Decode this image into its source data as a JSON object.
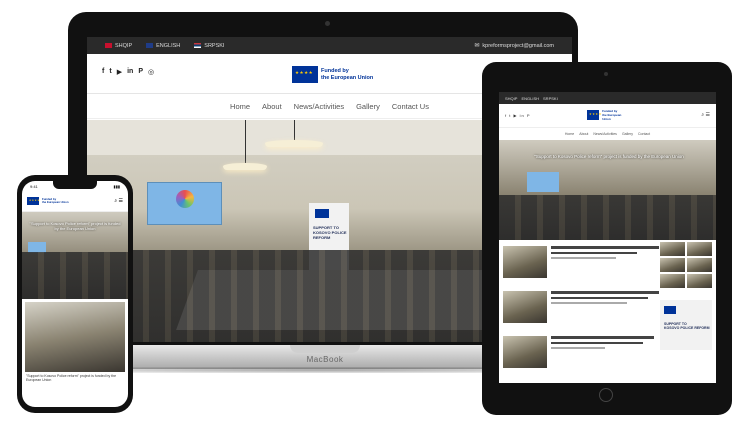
{
  "laptop": {
    "brand": "MacBook",
    "topbar": {
      "languages": [
        {
          "label": "SHQIP",
          "flag": "al"
        },
        {
          "label": "ENGLISH",
          "flag": "en"
        },
        {
          "label": "SRPSKI",
          "flag": "sr"
        }
      ],
      "email": "kpreformsproject@gmail.com"
    },
    "header": {
      "social_icons": [
        "facebook-icon",
        "twitter-icon",
        "youtube-icon",
        "linkedin-icon",
        "pinterest-icon",
        "instagram-icon"
      ],
      "social_glyphs": [
        "f",
        "t",
        "▶",
        "in",
        "P",
        "◎"
      ],
      "eu_logo_line1": "Funded by",
      "eu_logo_line2": "the European Union"
    },
    "nav": [
      "Home",
      "About",
      "News/Activities",
      "Gallery",
      "Contact Us"
    ],
    "hero": {
      "banner_line1": "SUPPORT TO",
      "banner_line2": "KOSOVO POLICE",
      "banner_line3": "REFORM"
    }
  },
  "tablet": {
    "topbar_items": [
      "SHQIP",
      "ENGLISH",
      "SRPSKI"
    ],
    "social": "f t ▶ in P",
    "nav": [
      "Home",
      "About",
      "News/Activities",
      "Gallery",
      "Contact"
    ],
    "hero_caption": "\"Support to Kosovo Police reform\" project is funded by the European Union",
    "icons": "⌕ ☰",
    "side_banner_line1": "SUPPORT TO",
    "side_banner_line2": "KOSOVO POLICE REFORM"
  },
  "phone": {
    "time": "9:41",
    "battery": "▮▮▮",
    "hero_caption": "\"Support to Kosovo Police reform\" project is funded by the European Union",
    "icons": "⌕ ☰",
    "bottom_caption": "\"Support to Kosovo Police reform\" project is funded by the European Union"
  },
  "colors": {
    "eu_blue": "#003399",
    "eu_yellow": "#ffcc00",
    "topbar": "#2a2a2a"
  }
}
